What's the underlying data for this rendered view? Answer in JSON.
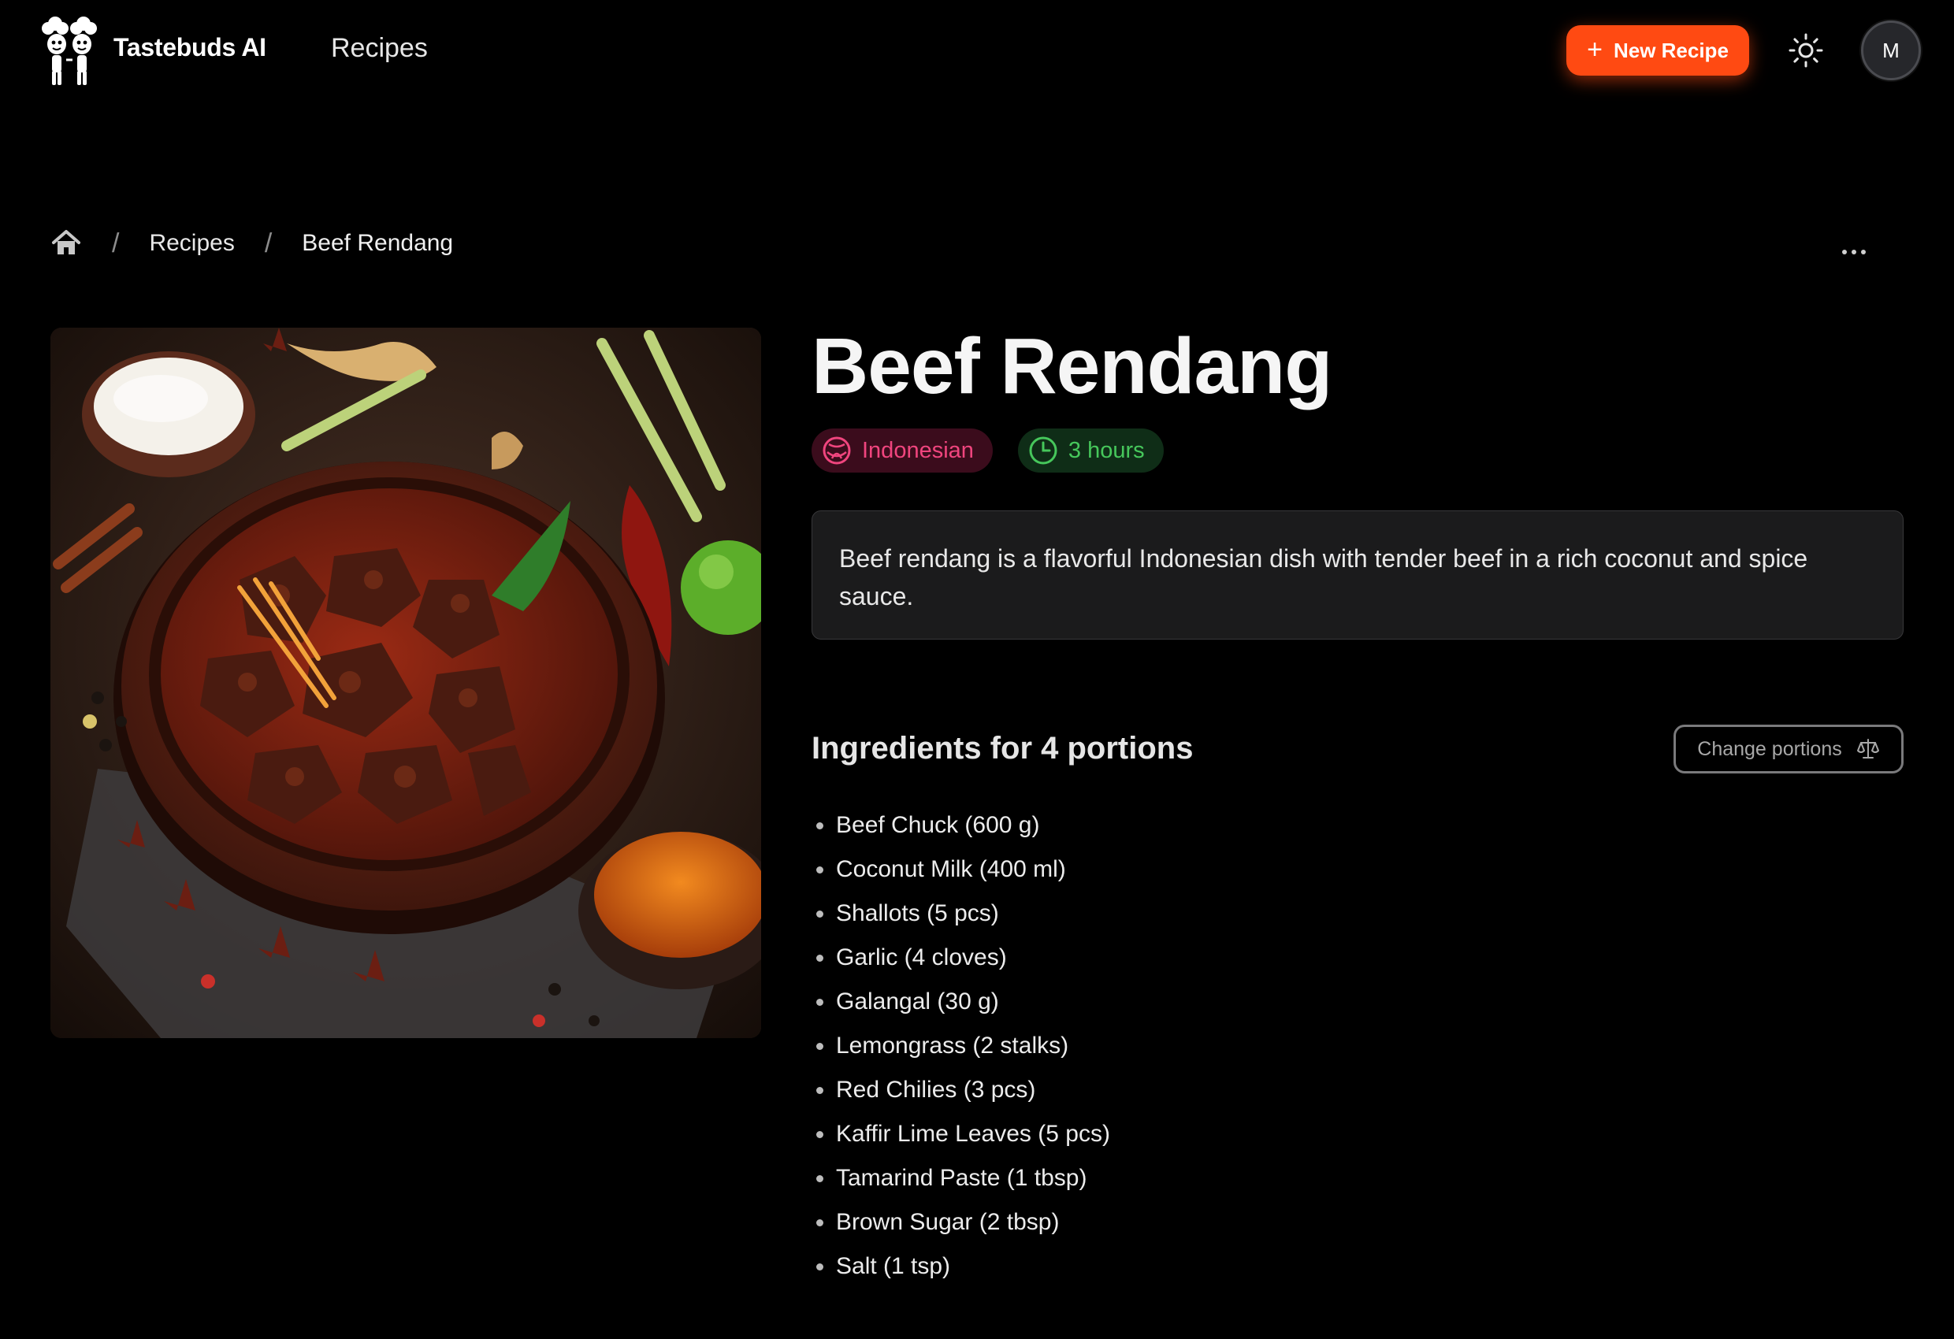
{
  "nav": {
    "brand": "Tastebuds AI",
    "recipes_link": "Recipes",
    "new_recipe_label": "New Recipe",
    "avatar_initial": "M",
    "icons": [
      "chef-logo-icon",
      "plus-icon",
      "sun-icon"
    ]
  },
  "breadcrumb": {
    "items": [
      "Recipes",
      "Beef Rendang"
    ],
    "icons": [
      "home-icon",
      "more-options-icon"
    ]
  },
  "recipe": {
    "title": "Beef Rendang",
    "cuisine": "Indonesian",
    "duration": "3 hours",
    "description": "Beef rendang is a flavorful Indonesian dish with tender beef in a rich coconut and spice sauce.",
    "ingredients_heading": "Ingredients for 4 portions",
    "change_portions_label": "Change portions",
    "ingredients": [
      "Beef Chuck (600 g)",
      "Coconut Milk (400 ml)",
      "Shallots (5 pcs)",
      "Garlic (4 cloves)",
      "Galangal (30 g)",
      "Lemongrass (2 stalks)",
      "Red Chilies (3 pcs)",
      "Kaffir Lime Leaves (5 pcs)",
      "Tamarind Paste (1 tbsp)",
      "Brown Sugar (2 tbsp)",
      "Salt (1 tsp)"
    ]
  },
  "colors": {
    "background": "#000000",
    "accent": "#ff4a12",
    "cuisine_tag_text": "#f0457e",
    "cuisine_tag_bg": "#3b0c1c",
    "time_tag_text": "#46c75b",
    "time_tag_bg": "#0f2d17"
  }
}
